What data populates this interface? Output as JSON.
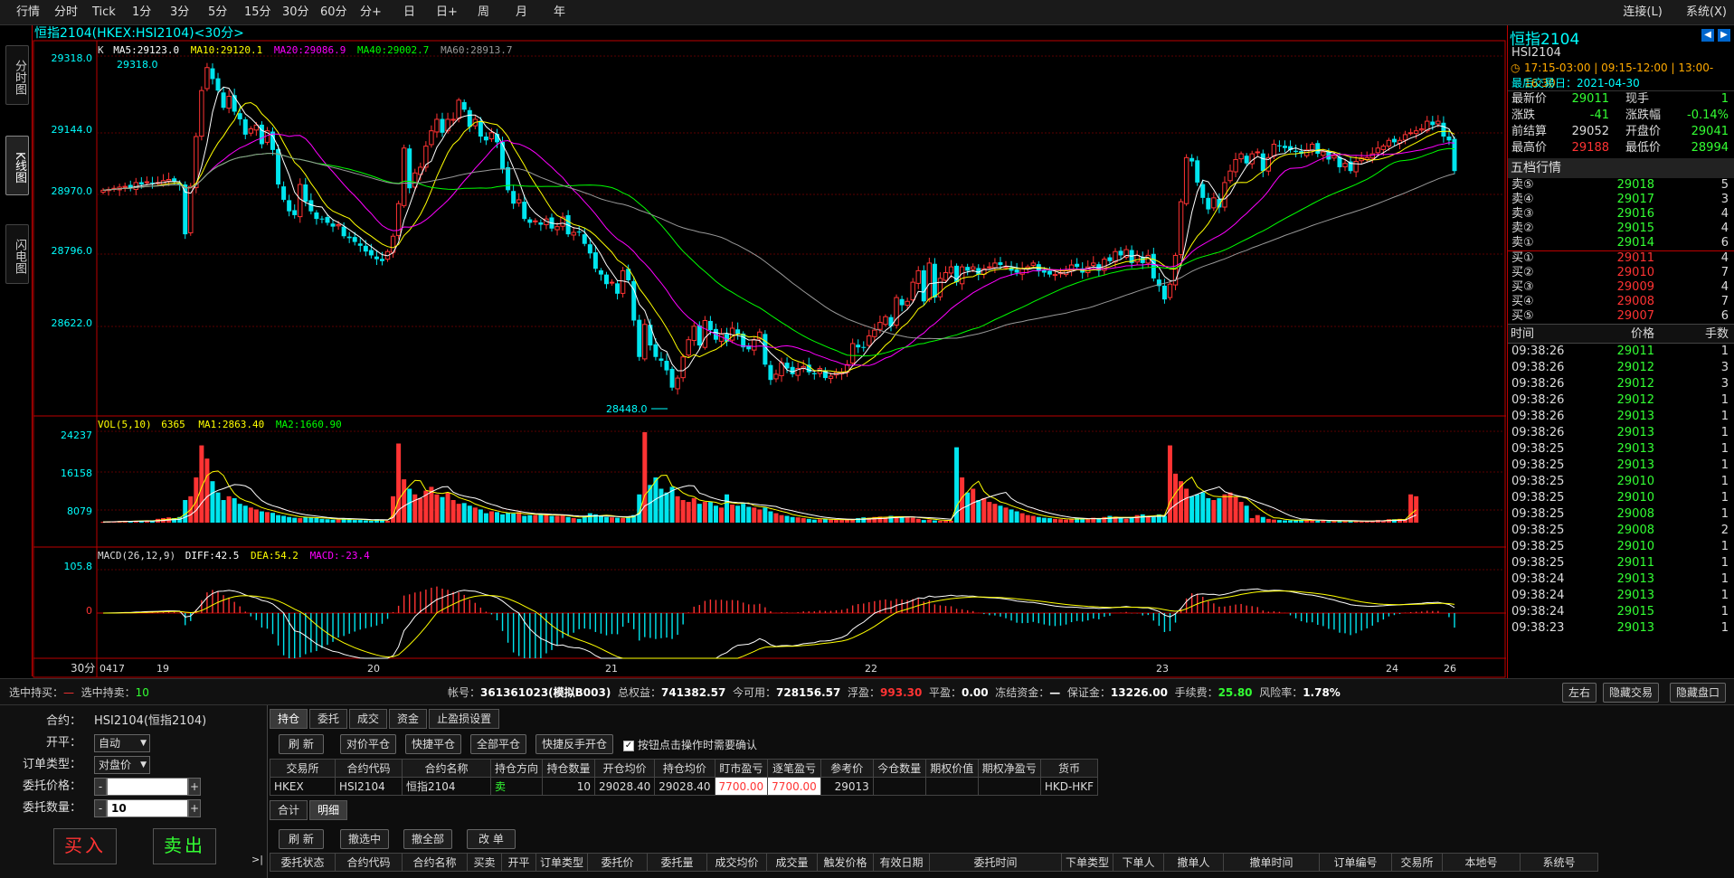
{
  "topbar": {
    "items": [
      "行情",
      "分时",
      "Tick",
      "1分",
      "3分",
      "5分",
      "15分",
      "30分",
      "60分",
      "分+",
      "日",
      "日+",
      "周",
      "月",
      "年"
    ],
    "connect": "连接(L)",
    "system": "系统(X)"
  },
  "sidetabs": {
    "timeshare": "分时图",
    "kline": "K线图",
    "flash": "闪电图"
  },
  "chart": {
    "title": "恒指2104(HKEX:HSI2104)<30分>",
    "ma_line": {
      "prefix": "K",
      "ma5": "MA5:29123.0",
      "ma10": "MA10:29120.1",
      "ma20": "MA20:29086.9",
      "ma40": "MA40:29002.7",
      "ma60": "MA60:28913.7"
    },
    "vol_line": {
      "label": "VOL(5,10)",
      "value": "6365",
      "ma1": "MA1:2863.40",
      "ma2": "MA2:1660.90"
    },
    "macd_line": {
      "label": "MACD(26,12,9)",
      "diff": "DIFF:42.5",
      "dea": "DEA:54.2",
      "macd": "MACD:-23.4"
    },
    "high_label": "29318.0",
    "low_label": "28448.0",
    "period": "30分",
    "price_axis": [
      "29318.0",
      "29144.0",
      "28970.0",
      "28796.0",
      "28622.0"
    ],
    "vol_axis": [
      "24237",
      "16158",
      "8079"
    ],
    "macd_axis": [
      "105.8",
      "0"
    ],
    "dates": [
      "0417",
      "19",
      "20",
      "21",
      "22",
      "23",
      "24",
      "26"
    ],
    "colors": {
      "up": "#ff3333",
      "down": "#00e5ee",
      "ma5": "#ffffff",
      "ma10": "#ffff00",
      "ma20": "#ff00ff",
      "ma40": "#00ff00",
      "ma60": "#999999"
    }
  },
  "chart_data": {
    "type": "candlestick",
    "title": "恒指2104(HKEX:HSI2104)<30分>",
    "ylim": [
      28420,
      29340
    ],
    "close": [
      28990,
      28992,
      28995,
      28998,
      29000,
      28995,
      29010,
      29005,
      29012,
      29008,
      29010,
      29015,
      29018,
      29013,
      29005,
      28875,
      29000,
      29130,
      29250,
      29310,
      29280,
      29250,
      29205,
      29235,
      29195,
      29175,
      29135,
      29150,
      29160,
      29110,
      29145,
      29095,
      29005,
      28965,
      28935,
      28925,
      29005,
      28960,
      28935,
      28915,
      28915,
      28905,
      28895,
      28900,
      28870,
      28865,
      28855,
      28845,
      28830,
      28820,
      28810,
      28805,
      28830,
      28870,
      28955,
      29100,
      28995,
      29035,
      29050,
      29105,
      29145,
      29175,
      29140,
      29175,
      29175,
      29225,
      29200,
      29155,
      29175,
      29130,
      29120,
      29140,
      29115,
      29045,
      28990,
      28955,
      28965,
      28915,
      28905,
      28910,
      28900,
      28915,
      28890,
      28895,
      28920,
      28875,
      28880,
      28880,
      28850,
      28825,
      28785,
      28770,
      28745,
      28750,
      28720,
      28780,
      28755,
      28650,
      28555,
      28640,
      28585,
      28555,
      28545,
      28520,
      28475,
      28500,
      28555,
      28600,
      28635,
      28585,
      28650,
      28625,
      28600,
      28615,
      28595,
      28630,
      28615,
      28580,
      28575,
      28600,
      28620,
      28535,
      28495,
      28510,
      28540,
      28525,
      28510,
      28525,
      28530,
      28515,
      28510,
      28525,
      28500,
      28505,
      28515,
      28515,
      28535,
      28590,
      28580,
      28580,
      28610,
      28625,
      28645,
      28660,
      28635,
      28710,
      28690,
      28700,
      28750,
      28780,
      28700,
      28800,
      28710,
      28760,
      28775,
      28790,
      28750,
      28790,
      28780,
      28790,
      28770,
      28785,
      28790,
      28800,
      28795,
      28790,
      28780,
      28775,
      28785,
      28790,
      28800,
      28780,
      28775,
      28770,
      28770,
      28775,
      28780,
      28795,
      28790,
      28775,
      28790,
      28800,
      28780,
      28810,
      28805,
      28830,
      28820,
      28835,
      28800,
      28820,
      28800,
      28820,
      28760,
      28740,
      28705,
      28745,
      28820,
      28960,
      29075,
      29065,
      29010,
      28970,
      28940,
      28970,
      28945,
      29010,
      29040,
      29070,
      29085,
      29060,
      29085,
      29090,
      29040,
      29075,
      29110,
      29105,
      29100,
      29095,
      29090,
      29085,
      29095,
      29110,
      29085,
      29090,
      29070,
      29080,
      29050,
      29060,
      29040,
      29065,
      29075,
      29075,
      29085,
      29100,
      29105,
      29120,
      29115,
      29120,
      29135,
      29140,
      29145,
      29150,
      29170,
      29160,
      29170,
      29130,
      29120,
      29040
    ],
    "volume": [
      200,
      250,
      300,
      400,
      500,
      350,
      500,
      550,
      600,
      400,
      1000,
      1200,
      1400,
      1200,
      1500,
      6000,
      7000,
      12000,
      20500,
      17000,
      11000,
      8000,
      6000,
      7000,
      6500,
      5000,
      4500,
      4000,
      3500,
      3000,
      2800,
      2600,
      2000,
      1800,
      1500,
      1300,
      1200,
      1500,
      1400,
      1200,
      1000,
      900,
      800,
      800,
      1200,
      900,
      700,
      700,
      600,
      500,
      900,
      700,
      500,
      7000,
      21000,
      11500,
      9000,
      7500,
      6500,
      8500,
      9500,
      7500,
      6800,
      8000,
      6000,
      5000,
      5200,
      4500,
      4000,
      3500,
      2500,
      3000,
      2800,
      2200,
      2600,
      2400,
      2800,
      1800,
      2000,
      2000,
      2200,
      2300,
      1800,
      1800,
      2000,
      1500,
      1200,
      1000,
      1800,
      2500,
      2200,
      1800,
      1500,
      1400,
      1300,
      1200,
      1600,
      2000,
      7500,
      24000,
      10000,
      12000,
      9000,
      8000,
      9500,
      7000,
      6000,
      5500,
      6500,
      5000,
      5500,
      5500,
      4500,
      4000,
      7500,
      4800,
      4500,
      5000,
      4200,
      4000,
      3500,
      4000,
      3000,
      2500,
      2000,
      1800,
      1500,
      1400,
      1200,
      1000,
      800,
      900,
      1000,
      800,
      700,
      700,
      800,
      900,
      1200,
      1400,
      1300,
      1500,
      1600,
      1400,
      1800,
      1500,
      1600,
      1500,
      1300,
      1000,
      700,
      800,
      600,
      500,
      500,
      500,
      20000,
      12000,
      8000,
      9000,
      6000,
      6500,
      5500,
      5000,
      4500,
      4000,
      3500,
      3000,
      2500,
      2000,
      1800,
      1500,
      1300,
      1200,
      1000,
      900,
      800,
      900,
      1200,
      1100,
      900,
      1300,
      1000,
      1500,
      1800,
      1600,
      1200,
      1000,
      1500,
      2000,
      2200,
      1800,
      1500,
      2200,
      1800,
      20500,
      13000,
      11000,
      9000,
      7000,
      7500,
      8000,
      6500,
      6000,
      6500,
      7500,
      8000,
      6800,
      5500,
      4500,
      1200,
      2000,
      1500,
      1000,
      800,
      700,
      600,
      600,
      700,
      800,
      700,
      600,
      500,
      500,
      400,
      400,
      500,
      500,
      400,
      500,
      300,
      400,
      500,
      700,
      600,
      900,
      900,
      1000,
      800,
      7500,
      7000
    ],
    "vol_ylim": [
      0,
      24237
    ],
    "macd_ylim": [
      -60,
      105.8
    ],
    "x": [
      "0417",
      "19",
      "20",
      "21",
      "22",
      "23",
      "24",
      "26"
    ],
    "series": [
      {
        "name": "MA5"
      },
      {
        "name": "MA10"
      },
      {
        "name": "MA20"
      },
      {
        "name": "MA40"
      },
      {
        "name": "MA60"
      }
    ],
    "grid": true
  },
  "quote": {
    "name": "恒指2104",
    "code": "HSI2104",
    "hours": "17:15-03:00 | 09:15-12:00 | 13:00-16:30",
    "last_day": "最后交易日：2021-04-30",
    "rows": [
      {
        "l1": "最新价",
        "v1": "29011",
        "c1": "g",
        "l2": "现手",
        "v2": "1",
        "c2": "g"
      },
      {
        "l1": "涨跌",
        "v1": "-41",
        "c1": "g",
        "l2": "涨跌幅",
        "v2": "-0.14%",
        "c2": "g"
      },
      {
        "l1": "前结算",
        "v1": "29052",
        "c1": "w",
        "l2": "开盘价",
        "v2": "29041",
        "c2": "g"
      },
      {
        "l1": "最高价",
        "v1": "29188",
        "c1": "r",
        "l2": "最低价",
        "v2": "28994",
        "c2": "g"
      }
    ],
    "depth_title": "五档行情",
    "asks": [
      {
        "label": "卖⑤",
        "price": "29018",
        "qty": "5"
      },
      {
        "label": "卖④",
        "price": "29017",
        "qty": "3"
      },
      {
        "label": "卖③",
        "price": "29016",
        "qty": "4"
      },
      {
        "label": "卖②",
        "price": "29015",
        "qty": "4"
      },
      {
        "label": "卖①",
        "price": "29014",
        "qty": "6"
      }
    ],
    "bids": [
      {
        "label": "买①",
        "price": "29011",
        "qty": "4"
      },
      {
        "label": "买②",
        "price": "29010",
        "qty": "7"
      },
      {
        "label": "买③",
        "price": "29009",
        "qty": "4"
      },
      {
        "label": "买④",
        "price": "29008",
        "qty": "7"
      },
      {
        "label": "买⑤",
        "price": "29007",
        "qty": "6"
      }
    ],
    "ticks_header": {
      "time": "时间",
      "price": "价格",
      "qty": "手数"
    },
    "ticks": [
      {
        "t": "09:38:26",
        "p": "29011",
        "q": "1"
      },
      {
        "t": "09:38:26",
        "p": "29012",
        "q": "3"
      },
      {
        "t": "09:38:26",
        "p": "29012",
        "q": "3"
      },
      {
        "t": "09:38:26",
        "p": "29012",
        "q": "1"
      },
      {
        "t": "09:38:26",
        "p": "29013",
        "q": "1"
      },
      {
        "t": "09:38:26",
        "p": "29013",
        "q": "1"
      },
      {
        "t": "09:38:25",
        "p": "29013",
        "q": "1"
      },
      {
        "t": "09:38:25",
        "p": "29013",
        "q": "1"
      },
      {
        "t": "09:38:25",
        "p": "29010",
        "q": "1"
      },
      {
        "t": "09:38:25",
        "p": "29010",
        "q": "1"
      },
      {
        "t": "09:38:25",
        "p": "29008",
        "q": "1"
      },
      {
        "t": "09:38:25",
        "p": "29008",
        "q": "2"
      },
      {
        "t": "09:38:25",
        "p": "29010",
        "q": "1"
      },
      {
        "t": "09:38:25",
        "p": "29011",
        "q": "1"
      },
      {
        "t": "09:38:24",
        "p": "29013",
        "q": "1"
      },
      {
        "t": "09:38:24",
        "p": "29013",
        "q": "1"
      },
      {
        "t": "09:38:24",
        "p": "29015",
        "q": "1"
      },
      {
        "t": "09:38:23",
        "p": "29013",
        "q": "1"
      }
    ]
  },
  "status": {
    "sel_buy": "选中持买：",
    "sel_buy_v": "—",
    "sel_sell": "选中持卖：",
    "sel_sell_v": "10",
    "account": "帐号：",
    "account_v": "361361023(模拟B003)",
    "equity": "总权益：",
    "equity_v": "741382.57",
    "avail": "今可用：",
    "avail_v": "728156.57",
    "float": "浮盈：",
    "float_v": "993.30",
    "pnl": "平盈：",
    "pnl_v": "0.00",
    "frozen": "冻结资金：",
    "frozen_v": "—",
    "margin": "保证金：",
    "margin_v": "13226.00",
    "fee": "手续费：",
    "fee_v": "25.80",
    "risk": "风险率：",
    "risk_v": "1.78%",
    "btn_lr": "左右",
    "btn_hide_trade": "隐藏交易",
    "btn_hide_win": "隐藏盘口"
  },
  "order": {
    "contract_l": "合约：",
    "contract_v": "HSI2104(恒指2104)",
    "open_l": "开平：",
    "open_v": "自动",
    "type_l": "订单类型：",
    "type_v": "对盘价",
    "price_l": "委托价格：",
    "price_v": "",
    "qty_l": "委托数量：",
    "qty_v": "10",
    "buy": "买入",
    "sell": "卖出",
    "collapse": ">|"
  },
  "positions": {
    "tabs": [
      "持仓",
      "委托",
      "成交",
      "资金",
      "止盈损设置"
    ],
    "buttons": [
      "刷 新",
      "对价平仓",
      "快捷平仓",
      "全部平仓",
      "快捷反手开仓"
    ],
    "confirm": "按钮点击操作时需要确认",
    "headers": [
      "交易所",
      "合约代码",
      "合约名称",
      "持仓方向",
      "持仓数量",
      "开仓均价",
      "持仓均价",
      "盯市盈亏",
      "逐笔盈亏",
      "参考价",
      "今仓数量",
      "期权价值",
      "期权净盈亏",
      "货币"
    ],
    "row": [
      "HKEX",
      "HSI2104",
      "恒指2104",
      "卖",
      "10",
      "29028.40",
      "29028.40",
      "7700.00",
      "7700.00",
      "29013",
      "",
      "",
      "",
      "HKD-HKF"
    ],
    "subtabs": [
      "合计",
      "明细"
    ],
    "order_buttons": [
      "刷 新",
      "撤选中",
      "撤全部",
      "改 单"
    ],
    "order_headers": [
      "委托状态",
      "合约代码",
      "合约名称",
      "买卖",
      "开平",
      "订单类型",
      "委托价",
      "委托量",
      "成交均价",
      "成交量",
      "触发价格",
      "有效日期",
      "委托时间",
      "下单类型",
      "下单人",
      "撤单人",
      "撤单时间",
      "订单编号",
      "交易所",
      "本地号",
      "系统号"
    ]
  }
}
